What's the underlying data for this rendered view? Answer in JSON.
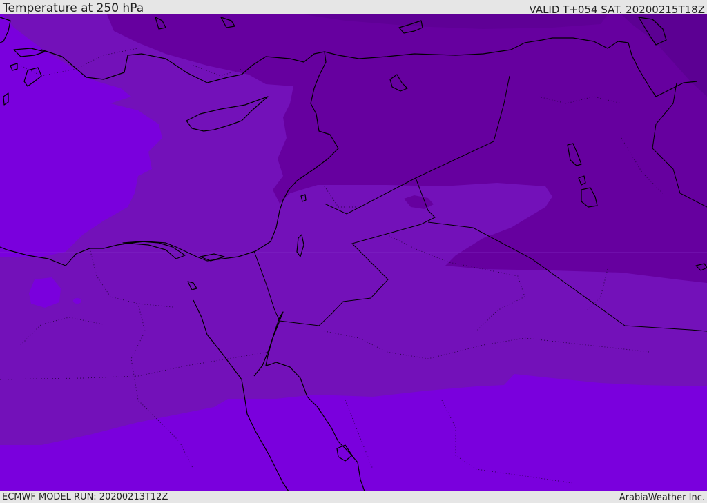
{
  "header": {
    "title": "Temperature at 250 hPa",
    "valid": "VALID T+054 SAT. 20200215T18Z"
  },
  "footer": {
    "model_run": "ECMWF MODEL RUN: 20200213T12Z",
    "credit": "ArabiaWeather Inc."
  },
  "map": {
    "region": "Eastern Mediterranean and Middle East",
    "colors": {
      "warmest": "#7a00dd",
      "warm": "#7311b9",
      "cold": "#66009f",
      "coldest": "#5c0093",
      "coastline": "#000000"
    }
  }
}
